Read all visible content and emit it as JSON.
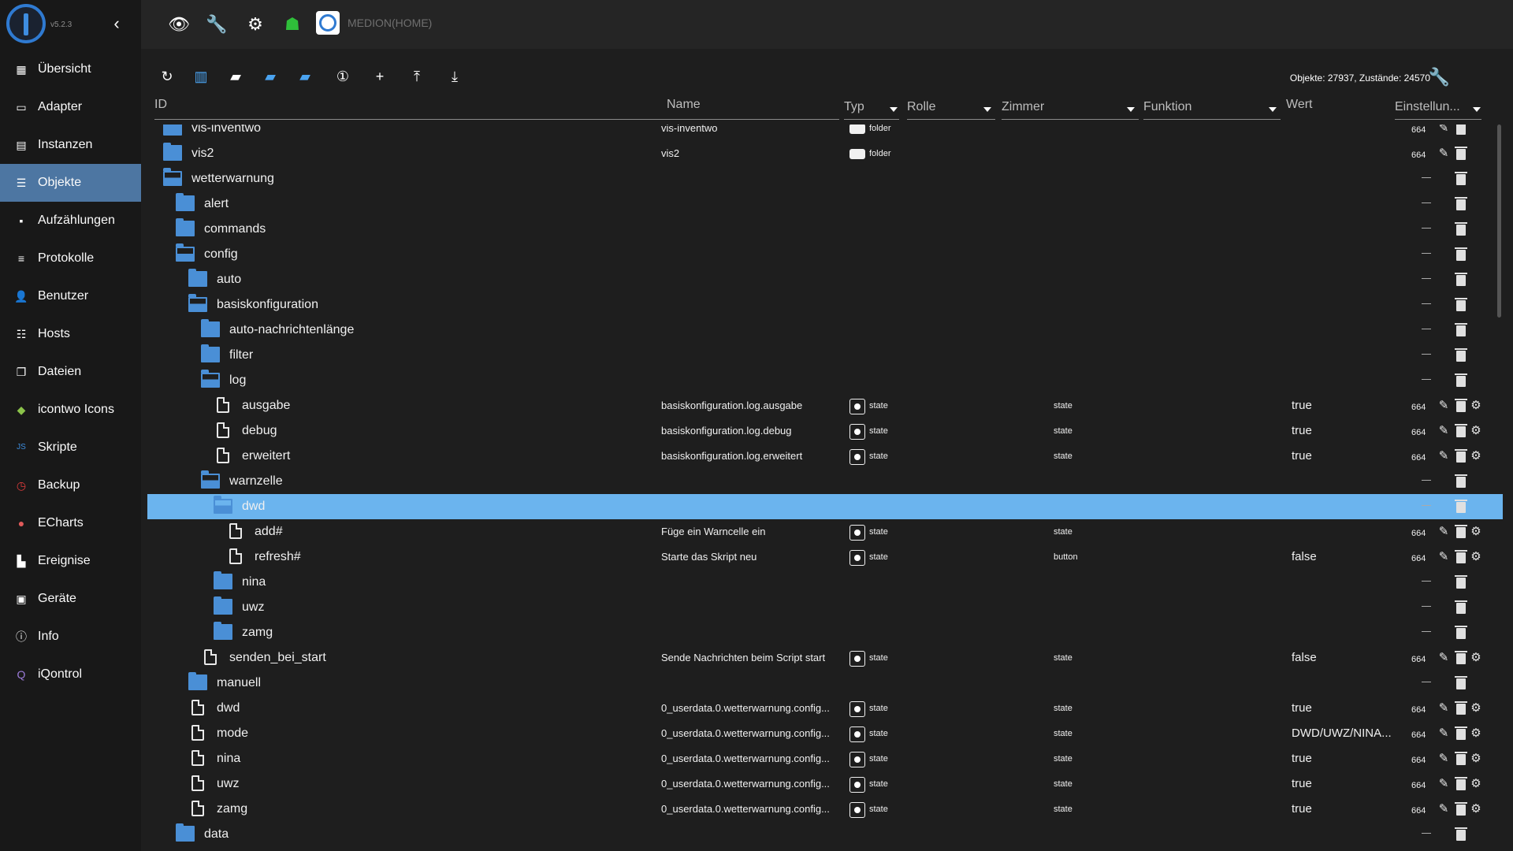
{
  "sidebar": {
    "version": "v5.2.3",
    "items": [
      {
        "label": "Übersicht",
        "icon": "grid-icon"
      },
      {
        "label": "Adapter",
        "icon": "store-icon"
      },
      {
        "label": "Instanzen",
        "icon": "instances-icon"
      },
      {
        "label": "Objekte",
        "icon": "list-icon",
        "active": true
      },
      {
        "label": "Aufzählungen",
        "icon": "enum-icon"
      },
      {
        "label": "Protokolle",
        "icon": "log-icon"
      },
      {
        "label": "Benutzer",
        "icon": "user-icon"
      },
      {
        "label": "Hosts",
        "icon": "hosts-icon"
      },
      {
        "label": "Dateien",
        "icon": "files-icon"
      },
      {
        "label": "icontwo Icons",
        "icon": "icontwo-icon"
      },
      {
        "label": "Skripte",
        "icon": "scripts-icon"
      },
      {
        "label": "Backup",
        "icon": "backup-icon"
      },
      {
        "label": "ECharts",
        "icon": "echarts-icon"
      },
      {
        "label": "Ereignise",
        "icon": "events-icon"
      },
      {
        "label": "Geräte",
        "icon": "devices-icon"
      },
      {
        "label": "Info",
        "icon": "info-icon"
      },
      {
        "label": "iQontrol",
        "icon": "iqontrol-icon"
      }
    ]
  },
  "topbar": {
    "host": "MEDION(HOME)"
  },
  "toolbar": {
    "stats": "Objekte: 27937, Zustände: 24570"
  },
  "columns": {
    "id": "ID",
    "name": "Name",
    "typ": "Typ",
    "rolle": "Rolle",
    "zimmer": "Zimmer",
    "funktion": "Funktion",
    "wert": "Wert",
    "einstellungen": "Einstellun..."
  },
  "rows": [
    {
      "label": "vis-inventwo",
      "indent": 0,
      "kind": "folder",
      "name": "vis-inventwo",
      "typ": "folder",
      "acl": "664",
      "actions": "ed"
    },
    {
      "label": "vis2",
      "indent": 0,
      "kind": "folder",
      "name": "vis2",
      "typ": "folder",
      "acl": "664",
      "actions": "ed"
    },
    {
      "label": "wetterwarnung",
      "indent": 0,
      "kind": "folder-open"
    },
    {
      "label": "alert",
      "indent": 1,
      "kind": "folder"
    },
    {
      "label": "commands",
      "indent": 1,
      "kind": "folder"
    },
    {
      "label": "config",
      "indent": 1,
      "kind": "folder-open"
    },
    {
      "label": "auto",
      "indent": 2,
      "kind": "folder"
    },
    {
      "label": "basiskonfiguration",
      "indent": 2,
      "kind": "folder-open"
    },
    {
      "label": "auto-nachrichtenlänge",
      "indent": 3,
      "kind": "folder"
    },
    {
      "label": "filter",
      "indent": 3,
      "kind": "folder"
    },
    {
      "label": "log",
      "indent": 3,
      "kind": "folder-open"
    },
    {
      "label": "ausgabe",
      "indent": 4,
      "kind": "file",
      "name": "basiskonfiguration.log.ausgabe",
      "typ": "state",
      "role": "state",
      "value": "true",
      "acl": "664",
      "actions": "eds"
    },
    {
      "label": "debug",
      "indent": 4,
      "kind": "file",
      "name": "basiskonfiguration.log.debug",
      "typ": "state",
      "role": "state",
      "value": "true",
      "acl": "664",
      "actions": "eds"
    },
    {
      "label": "erweitert",
      "indent": 4,
      "kind": "file",
      "name": "basiskonfiguration.log.erweitert",
      "typ": "state",
      "role": "state",
      "value": "true",
      "acl": "664",
      "actions": "eds"
    },
    {
      "label": "warnzelle",
      "indent": 3,
      "kind": "folder-open"
    },
    {
      "label": "dwd",
      "indent": 4,
      "kind": "folder-open",
      "selected": true
    },
    {
      "label": "add#",
      "indent": 5,
      "kind": "file",
      "name": "Füge ein Warncelle ein",
      "typ": "state",
      "role": "state",
      "acl": "664",
      "actions": "eds"
    },
    {
      "label": "refresh#",
      "indent": 5,
      "kind": "file",
      "name": "Starte das Skript neu",
      "typ": "state",
      "role": "button",
      "value": "false",
      "acl": "664",
      "actions": "eds"
    },
    {
      "label": "nina",
      "indent": 4,
      "kind": "folder"
    },
    {
      "label": "uwz",
      "indent": 4,
      "kind": "folder"
    },
    {
      "label": "zamg",
      "indent": 4,
      "kind": "folder"
    },
    {
      "label": "senden_bei_start",
      "indent": 3,
      "kind": "file",
      "name": "Sende Nachrichten beim Script start",
      "typ": "state",
      "role": "state",
      "value": "false",
      "acl": "664",
      "actions": "eds"
    },
    {
      "label": "manuell",
      "indent": 2,
      "kind": "folder"
    },
    {
      "label": "dwd",
      "indent": 2,
      "kind": "file",
      "name": "0_userdata.0.wetterwarnung.config...",
      "typ": "state",
      "role": "state",
      "value": "true",
      "acl": "664",
      "actions": "eds"
    },
    {
      "label": "mode",
      "indent": 2,
      "kind": "file",
      "name": "0_userdata.0.wetterwarnung.config...",
      "typ": "state",
      "role": "state",
      "value": "DWD/UWZ/NINA...",
      "acl": "664",
      "actions": "eds"
    },
    {
      "label": "nina",
      "indent": 2,
      "kind": "file",
      "name": "0_userdata.0.wetterwarnung.config...",
      "typ": "state",
      "role": "state",
      "value": "true",
      "acl": "664",
      "actions": "eds"
    },
    {
      "label": "uwz",
      "indent": 2,
      "kind": "file",
      "name": "0_userdata.0.wetterwarnung.config...",
      "typ": "state",
      "role": "state",
      "value": "true",
      "acl": "664",
      "actions": "eds"
    },
    {
      "label": "zamg",
      "indent": 2,
      "kind": "file",
      "name": "0_userdata.0.wetterwarnung.config...",
      "typ": "state",
      "role": "state",
      "value": "true",
      "acl": "664",
      "actions": "eds"
    },
    {
      "label": "data",
      "indent": 1,
      "kind": "folder"
    }
  ]
}
